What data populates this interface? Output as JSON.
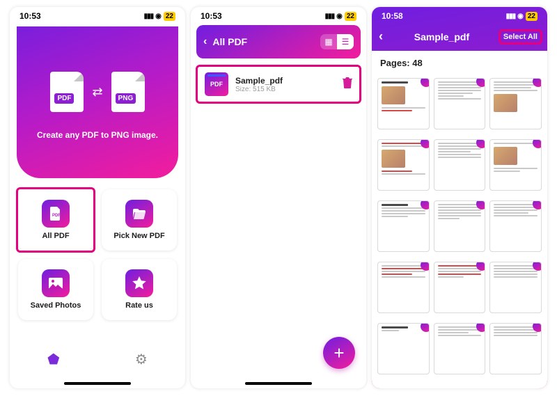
{
  "status": {
    "time1": "10:53",
    "time2": "10:53",
    "time3": "10:58",
    "battery": "22"
  },
  "screen1": {
    "hero": {
      "left_badge": "PDF",
      "right_badge": "PNG",
      "tagline": "Create any PDF to PNG image."
    },
    "tiles": {
      "all_pdf": "All PDF",
      "pick_new": "Pick New PDF",
      "saved": "Saved Photos",
      "rate": "Rate us"
    }
  },
  "screen2": {
    "title": "All PDF",
    "file": {
      "name": "Sample_pdf",
      "size": "Size: 515 KB",
      "thumb_label": "PDF"
    }
  },
  "screen3": {
    "title": "Sample_pdf",
    "select_all": "Select All",
    "pages_label": "Pages: 48"
  }
}
